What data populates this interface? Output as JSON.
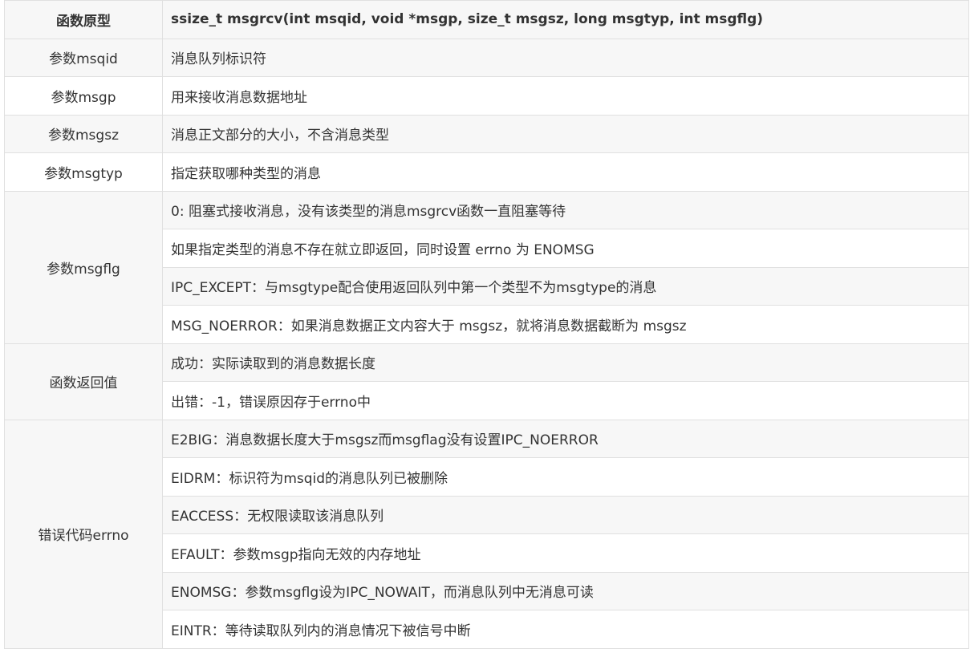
{
  "header": {
    "label": "函数原型",
    "value": "ssize_t msgrcv(int msqid, void *msgp, size_t msgsz, long msgtyp, int msgflg)"
  },
  "rows": [
    {
      "label": "参数msqid",
      "values": [
        "消息队列标识符"
      ]
    },
    {
      "label": "参数msgp",
      "values": [
        "用来接收消息数据地址"
      ]
    },
    {
      "label": "参数msgsz",
      "values": [
        "消息正文部分的大小，不含消息类型"
      ]
    },
    {
      "label": "参数msgtyp",
      "values": [
        "指定获取哪种类型的消息"
      ]
    },
    {
      "label": "参数msgflg",
      "values": [
        "0: 阻塞式接收消息，没有该类型的消息msgrcv函数一直阻塞等待",
        "如果指定类型的消息不存在就立即返回，同时设置 errno 为 ENOMSG",
        "IPC_EXCEPT：与msgtype配合使用返回队列中第一个类型不为msgtype的消息",
        "MSG_NOERROR：如果消息数据正文内容大于 msgsz，就将消息数据截断为 msgsz"
      ]
    },
    {
      "label": "函数返回值",
      "values": [
        "成功：实际读取到的消息数据长度",
        "出错：-1，错误原因存于errno中"
      ]
    },
    {
      "label": "错误代码errno",
      "values": [
        "E2BIG：消息数据长度大于msgsz而msgflag没有设置IPC_NOERROR",
        "EIDRM：标识符为msqid的消息队列已被删除",
        "EACCESS：无权限读取该消息队列",
        "EFAULT：参数msgp指向无效的内存地址",
        "ENOMSG：参数msgflg设为IPC_NOWAIT，而消息队列中无消息可读",
        "EINTR：等待读取队列内的消息情况下被信号中断"
      ]
    }
  ]
}
